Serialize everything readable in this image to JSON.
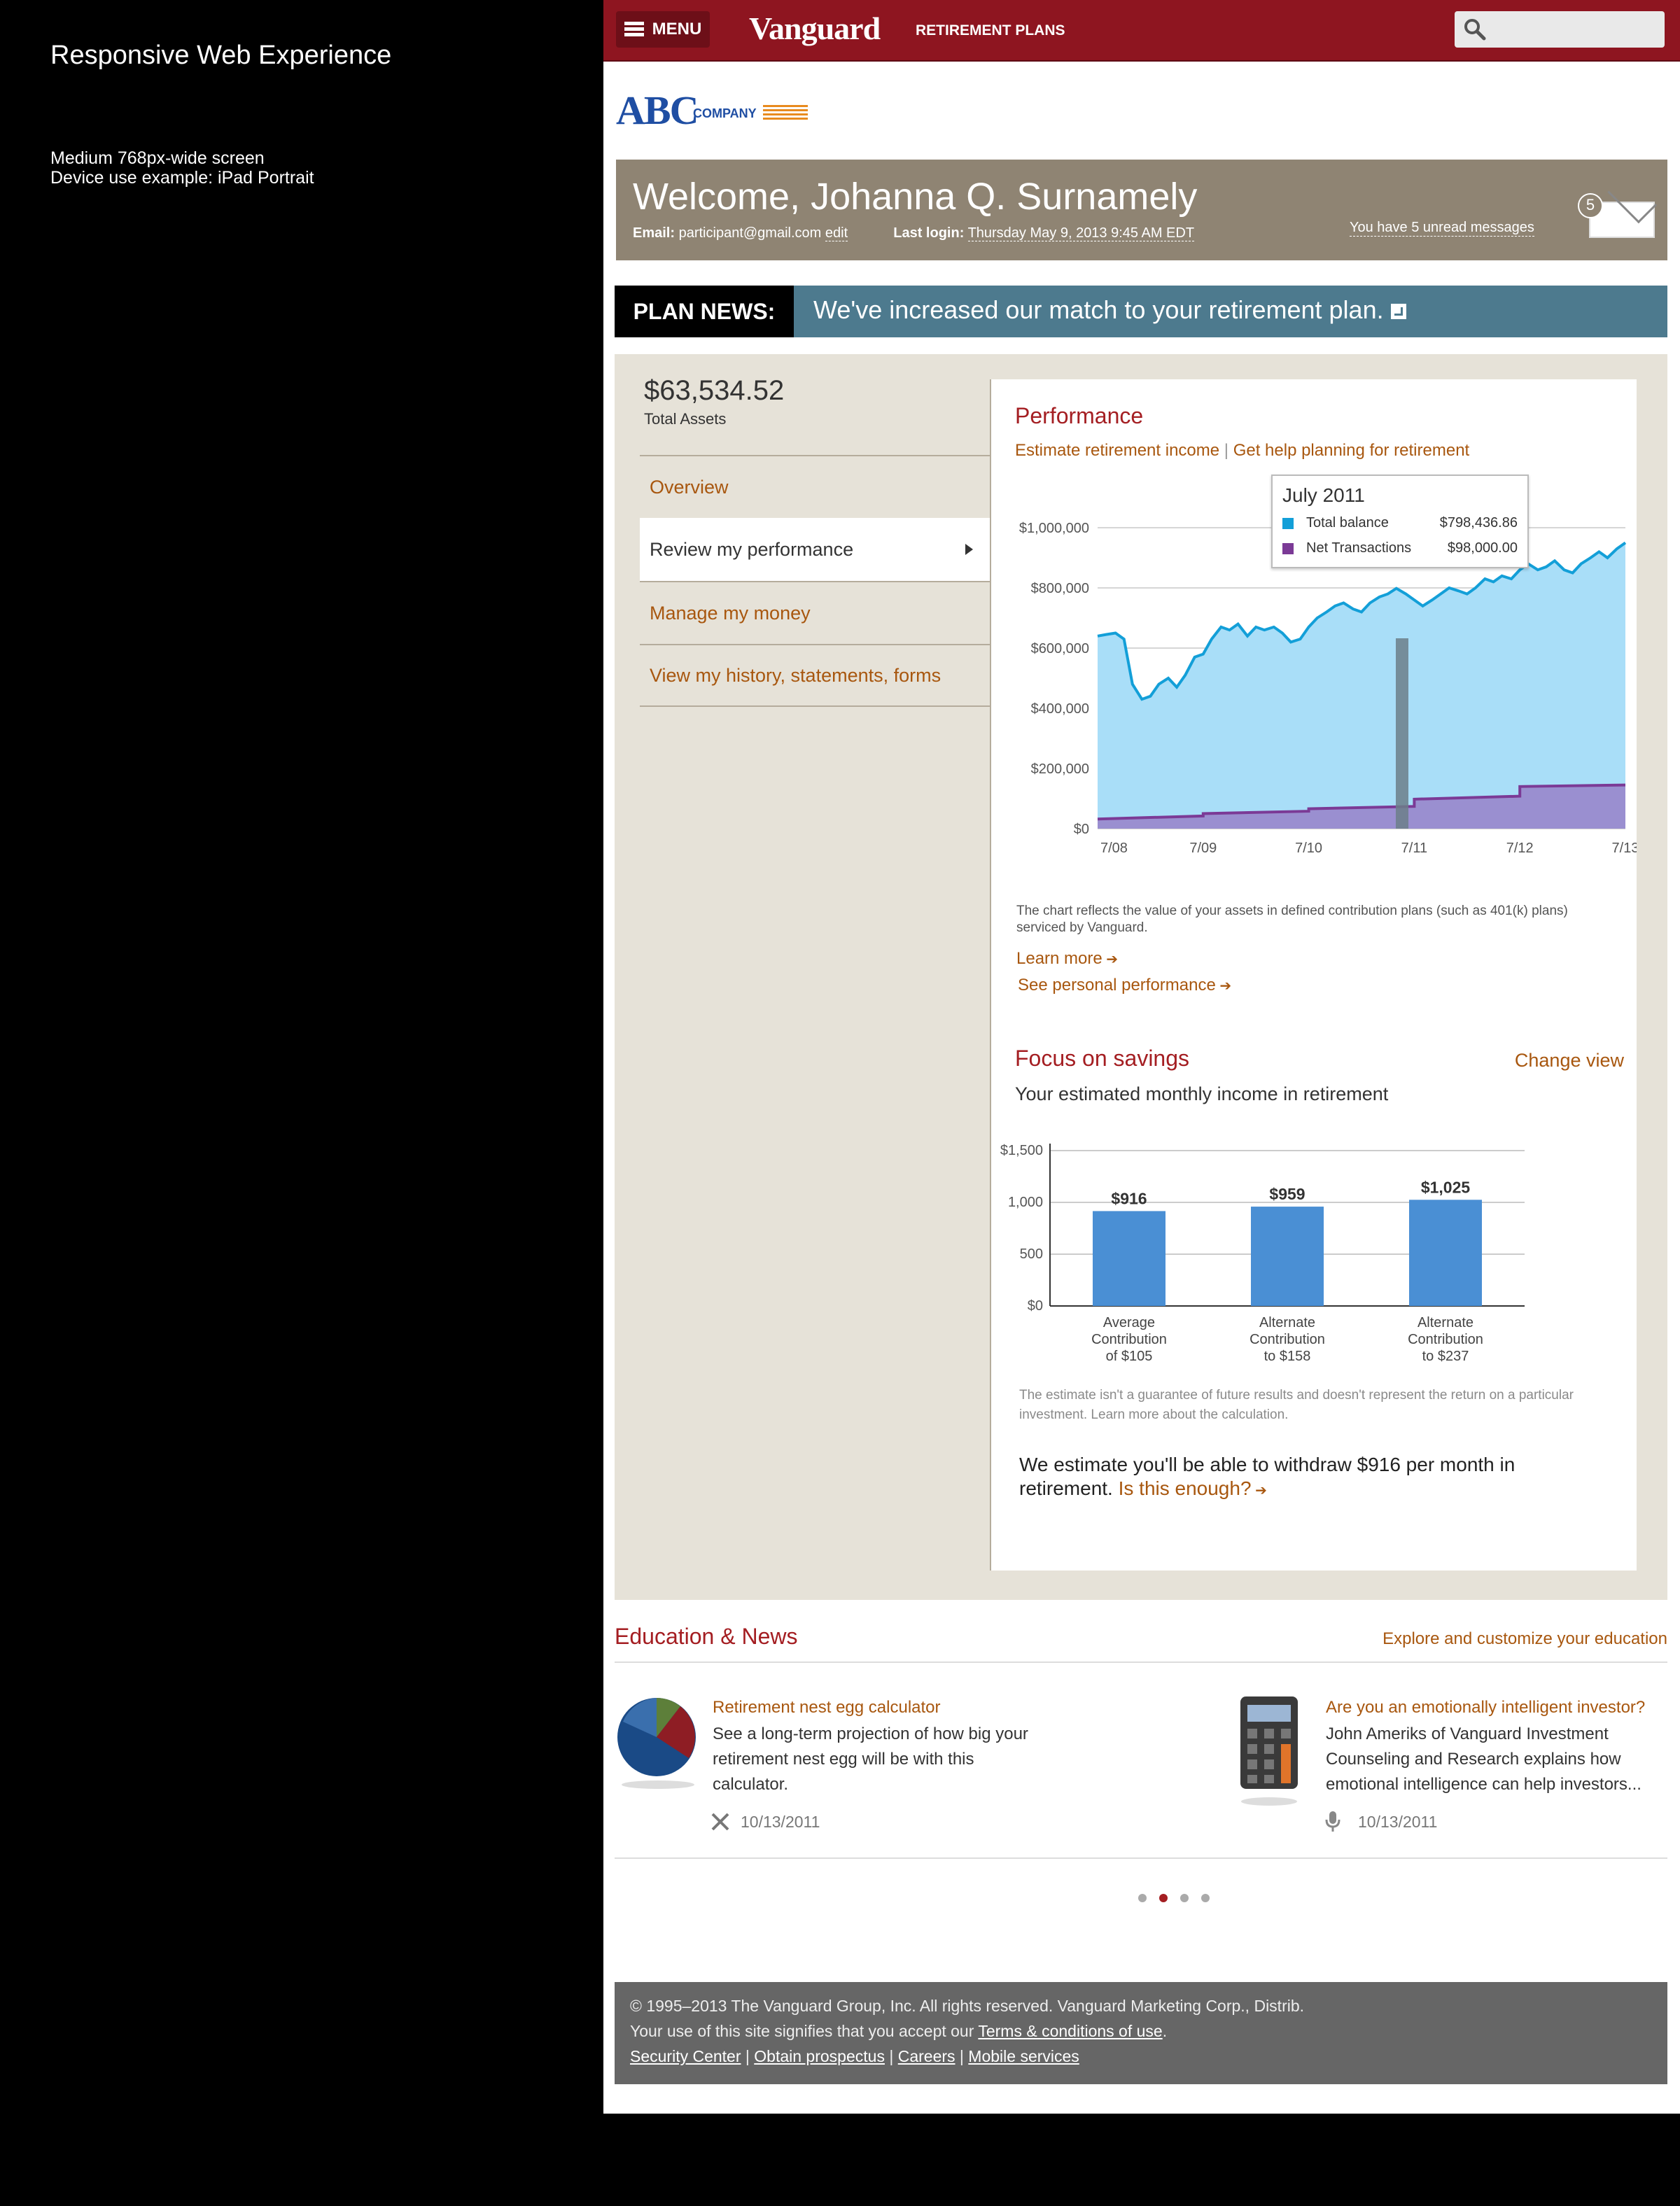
{
  "annotation": {
    "title": "Responsive Web Experience",
    "line1": "Medium 768px-wide screen",
    "line2": "Device use example: iPad Portrait"
  },
  "header": {
    "menu_label": "MENU",
    "brand": "Vanguard",
    "brand_sub": "RETIREMENT PLANS",
    "search_placeholder": ""
  },
  "company_logo": {
    "abc": "ABC",
    "company": "COMPANY"
  },
  "welcome": {
    "greeting": "Welcome, Johanna Q. Surnamely",
    "email_label": "Email:",
    "email": "participant@gmail.com",
    "edit": "edit",
    "last_login_label": "Last login:",
    "last_login": "Thursday May 9, 2013 9:45 AM EDT",
    "unread_text": "You have 5 unread messages",
    "unread_count": "5"
  },
  "plan_news": {
    "label": "PLAN NEWS:",
    "text": "We've increased our match to your retirement plan."
  },
  "summary": {
    "total_value": "$63,534.52",
    "total_label": "Total Assets"
  },
  "nav": {
    "items": [
      {
        "label": "Overview",
        "active": false
      },
      {
        "label": "Review my performance",
        "active": true
      },
      {
        "label": "Manage my money",
        "active": false
      },
      {
        "label": "View my history, statements, forms",
        "active": false
      }
    ]
  },
  "performance": {
    "title": "Performance",
    "link1": "Estimate retirement income",
    "link2": "Get help planning for retirement",
    "tooltip": {
      "title": "July 2011",
      "row1_label": "Total balance",
      "row1_value": "$798,436.86",
      "row2_label": "Net Transactions",
      "row2_value": "$98,000.00"
    },
    "note": "The chart reflects the value of your assets in defined contribution plans (such as 401(k) plans) serviced by Vanguard.",
    "learn_more": "Learn more",
    "see_personal": "See personal performance"
  },
  "savings": {
    "title": "Focus on savings",
    "change_view": "Change view",
    "subtitle": "Your estimated monthly income in retirement",
    "disclaimer": "The estimate isn't a guarantee of future results and doesn't represent the return on a particular investment. Learn more about the calculation.",
    "estimate_text": "We estimate you'll be able to withdraw $916 per month in retirement.",
    "is_enough": "Is this enough?"
  },
  "chart_data": [
    {
      "type": "area",
      "x_ticks": [
        "7/08",
        "7/09",
        "7/10",
        "7/11",
        "7/12",
        "7/13"
      ],
      "y_ticks": [
        "$1,000,000",
        "$800,000",
        "$600,000",
        "$400,000",
        "$200,000",
        "$0"
      ],
      "ylim": [
        0,
        1000000
      ],
      "grid": true,
      "series": [
        {
          "name": "Total balance",
          "color": "#139fd8",
          "fill": "#a9def8",
          "x": [
            2008.5,
            2008.58,
            2008.67,
            2008.75,
            2008.83,
            2008.92,
            2009.0,
            2009.08,
            2009.17,
            2009.25,
            2009.33,
            2009.42,
            2009.5,
            2009.58,
            2009.67,
            2009.75,
            2009.83,
            2009.92,
            2010.0,
            2010.08,
            2010.17,
            2010.25,
            2010.33,
            2010.42,
            2010.5,
            2010.58,
            2010.67,
            2010.75,
            2010.83,
            2010.92,
            2011.0,
            2011.08,
            2011.17,
            2011.25,
            2011.33,
            2011.42,
            2011.5,
            2011.58,
            2011.67,
            2011.75,
            2011.83,
            2011.92,
            2012.0,
            2012.08,
            2012.17,
            2012.25,
            2012.33,
            2012.42,
            2012.5,
            2012.58,
            2012.67,
            2012.75,
            2012.83,
            2012.92,
            2013.0,
            2013.08,
            2013.17,
            2013.25,
            2013.33,
            2013.42,
            2013.5
          ],
          "y": [
            640000,
            645000,
            650000,
            630000,
            480000,
            430000,
            440000,
            480000,
            500000,
            470000,
            510000,
            570000,
            580000,
            630000,
            670000,
            660000,
            680000,
            640000,
            670000,
            660000,
            670000,
            650000,
            620000,
            630000,
            670000,
            700000,
            720000,
            740000,
            750000,
            730000,
            720000,
            750000,
            770000,
            780000,
            798436,
            780000,
            760000,
            740000,
            760000,
            780000,
            800000,
            790000,
            780000,
            800000,
            830000,
            820000,
            840000,
            830000,
            860000,
            880000,
            860000,
            870000,
            890000,
            860000,
            850000,
            880000,
            900000,
            920000,
            900000,
            930000,
            950000
          ]
        },
        {
          "name": "Net Transactions",
          "color": "#7b3a96",
          "fill": "#9a8fd0",
          "x": [
            2008.5,
            2009.5,
            2009.5,
            2010.5,
            2010.5,
            2011.5,
            2011.5,
            2012.5,
            2012.5,
            2013.5
          ],
          "y": [
            32000,
            42000,
            50000,
            58000,
            66000,
            74000,
            98000,
            108000,
            140000,
            145000
          ]
        }
      ]
    },
    {
      "type": "bar",
      "categories": [
        "Average Contribution of $105",
        "Alternate Contribution to $158",
        "Alternate Contribution to $237"
      ],
      "category_lines": [
        [
          "Average",
          "Contribution",
          "of $105"
        ],
        [
          "Alternate",
          "Contribution",
          "to $158"
        ],
        [
          "Alternate",
          "Contribution",
          "to $237"
        ]
      ],
      "values": [
        916,
        959,
        1025
      ],
      "value_labels": [
        "$916",
        "$959",
        "$1,025"
      ],
      "y_ticks": [
        "$1,500",
        "1,000",
        "500",
        "$0"
      ],
      "ylim": [
        0,
        1500
      ],
      "color": "#4a8fd4",
      "grid": true
    }
  ],
  "education": {
    "title": "Education & News",
    "explore": "Explore and customize your education",
    "cards": [
      {
        "title": "Retirement nest egg calculator",
        "body": [
          "See a long-term projection of how big your",
          "retirement nest egg will be with this",
          "calculator."
        ],
        "date": "10/13/2011",
        "icon": "pie-chart-icon",
        "meta_icon": "tools-icon"
      },
      {
        "title": "Are you an emotionally intelligent investor?",
        "body": [
          "John Ameriks of Vanguard Investment",
          "Counseling and Research explains how",
          "emotional intelligence can help investors..."
        ],
        "date": "10/13/2011",
        "icon": "calculator-icon",
        "meta_icon": "microphone-icon"
      }
    ]
  },
  "pagination": {
    "total": 4,
    "active": 2
  },
  "footer": {
    "line1": "© 1995–2013  The Vanguard Group, Inc. All rights reserved. Vanguard Marketing Corp., Distrib.",
    "line2_prefix": "Your use of this site signifies that you accept our ",
    "terms": "Terms & conditions of use",
    "line2_suffix": ".",
    "links": [
      "Security Center",
      "Obtain prospectus",
      "Careers",
      "Mobile services"
    ]
  }
}
